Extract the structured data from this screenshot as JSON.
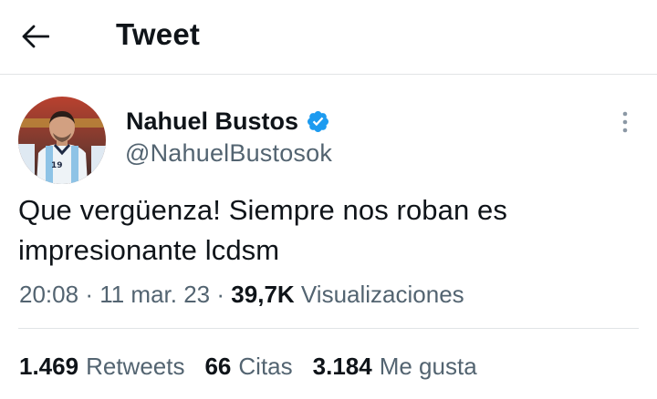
{
  "header": {
    "title": "Tweet",
    "back_icon": "arrow-left-icon"
  },
  "author": {
    "display_name": "Nahuel Bustos",
    "handle": "@NahuelBustosok",
    "verified": true,
    "verified_color": "#1d9bf0",
    "avatar_jersey_number": "19"
  },
  "tweet": {
    "text_line1": "Que vergüenza! Siempre nos roban es",
    "text_line2": "impresionante lcdsm"
  },
  "meta": {
    "time": "20:08",
    "separator": "·",
    "date": "11 mar. 23",
    "views_count": "39,7K",
    "views_label": "Visualizaciones"
  },
  "stats": {
    "retweets_count": "1.469",
    "retweets_label": "Retweets",
    "quotes_count": "66",
    "quotes_label": "Citas",
    "likes_count": "3.184",
    "likes_label": "Me gusta"
  }
}
